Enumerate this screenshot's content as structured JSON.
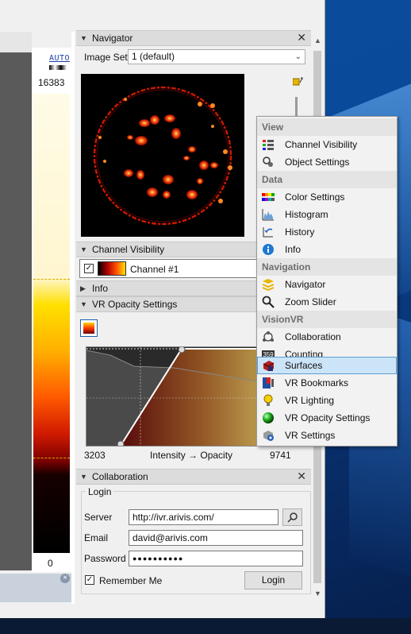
{
  "lut": {
    "auto_label": "AUTO",
    "max_value": "16383",
    "min_value": "0"
  },
  "navigator": {
    "title": "Navigator",
    "image_set_label": "Image Set:",
    "image_set_value": "1 (default)"
  },
  "channel_visibility": {
    "title": "Channel Visibility",
    "channel_name": "Channel #1",
    "checked": "✓"
  },
  "info": {
    "title": "Info"
  },
  "vr_opacity": {
    "title": "VR Opacity Settings",
    "min_value": "3203",
    "axis_label": "Intensity → Opacity",
    "max_value": "9741"
  },
  "collaboration": {
    "title": "Collaboration",
    "group_label": "Login",
    "server_label": "Server",
    "server_value": "http://ivr.arivis.com/",
    "email_label": "Email",
    "email_value": "david@arivis.com",
    "password_label": "Password",
    "password_value": "●●●●●●●●●●",
    "remember_label": "Remember Me",
    "remember_checked": "✓",
    "login_button": "Login"
  },
  "menu": {
    "sections": [
      {
        "header": "View",
        "items": [
          {
            "label": "Channel Visibility",
            "icon": "channel-visibility-icon"
          },
          {
            "label": "Object Settings",
            "icon": "object-settings-icon"
          }
        ]
      },
      {
        "header": "Data",
        "items": [
          {
            "label": "Color Settings",
            "icon": "color-settings-icon"
          },
          {
            "label": "Histogram",
            "icon": "histogram-icon"
          },
          {
            "label": "History",
            "icon": "history-icon"
          },
          {
            "label": "Info",
            "icon": "info-icon"
          }
        ]
      },
      {
        "header": "Navigation",
        "items": [
          {
            "label": "Navigator",
            "icon": "navigator-icon"
          },
          {
            "label": "Zoom Slider",
            "icon": "zoom-icon"
          }
        ]
      },
      {
        "header": "VisionVR",
        "items": [
          {
            "label": "Collaboration",
            "icon": "collaboration-icon"
          },
          {
            "label": "Counting",
            "icon": "counting-icon"
          },
          {
            "label": "Surfaces",
            "icon": "surfaces-icon",
            "selected": true
          },
          {
            "label": "VR Bookmarks",
            "icon": "bookmarks-icon"
          },
          {
            "label": "VR Lighting",
            "icon": "lighting-icon"
          },
          {
            "label": "VR Opacity Settings",
            "icon": "opacity-icon"
          },
          {
            "label": "VR Settings",
            "icon": "vr-settings-icon"
          }
        ]
      }
    ]
  },
  "colors": {
    "selection": "#cce4f7",
    "selection_border": "#5a9fd6",
    "menu_header": "#6d6d6d"
  }
}
